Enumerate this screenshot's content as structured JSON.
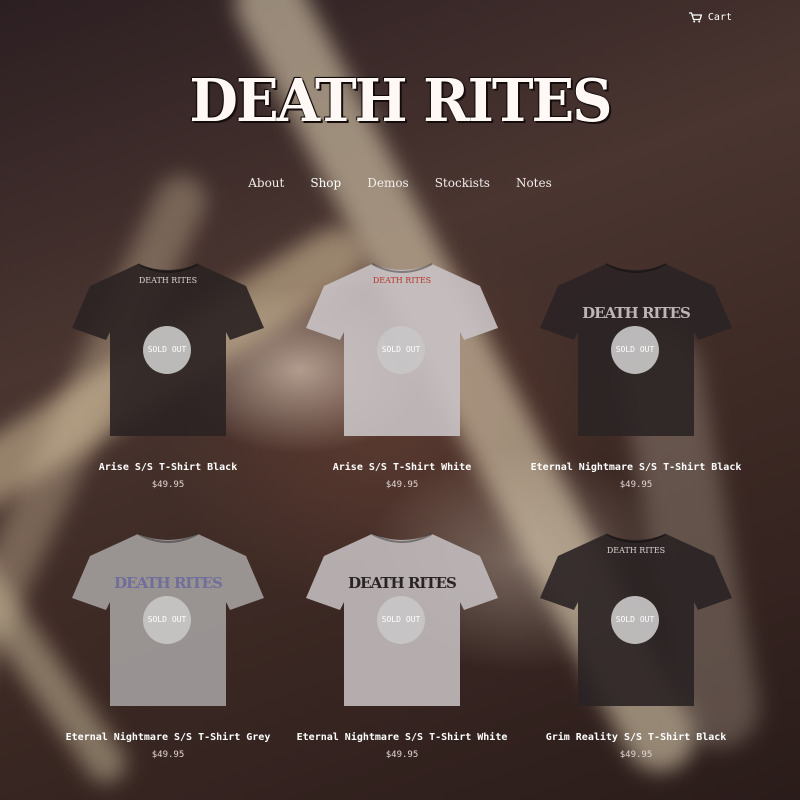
{
  "header": {
    "cart_label": "Cart",
    "cart_icon": "cart-icon",
    "logo_text": "DEATH RITES"
  },
  "nav": {
    "items": [
      {
        "label": "About"
      },
      {
        "label": "Shop",
        "active": true
      },
      {
        "label": "Demos"
      },
      {
        "label": "Stockists"
      },
      {
        "label": "Notes"
      }
    ]
  },
  "products": [
    {
      "title": "Arise S/S T-Shirt Black",
      "price": "$49.95",
      "badge": "SOLD OUT",
      "shirt_color": "#2a2222",
      "print": "small",
      "print_text": "DEATH RITES"
    },
    {
      "title": "Arise S/S T-Shirt White",
      "price": "$49.95",
      "badge": "SOLD OUT",
      "shirt_color": "#c9c2c4",
      "print": "small",
      "print_text": "DEATH RITES"
    },
    {
      "title": "Eternal Nightmare S/S T-Shirt Black",
      "price": "$49.95",
      "badge": "SOLD OUT",
      "shirt_color": "#2b2325",
      "print": "large",
      "print_text": "DEATH RITES"
    },
    {
      "title": "Eternal Nightmare S/S T-Shirt Grey",
      "price": "$49.95",
      "badge": "SOLD OUT",
      "shirt_color": "#a39e9e",
      "print": "large",
      "print_text": "DEATH RITES"
    },
    {
      "title": "Eternal Nightmare S/S T-Shirt White",
      "price": "$49.95",
      "badge": "SOLD OUT",
      "shirt_color": "#c2bbbc",
      "print": "large",
      "print_text": "DEATH RITES"
    },
    {
      "title": "Grim Reality S/S T-Shirt Black",
      "price": "$49.95",
      "badge": "SOLD OUT",
      "shirt_color": "#2a2223",
      "print": "small",
      "print_text": "DEATH RITES"
    }
  ]
}
